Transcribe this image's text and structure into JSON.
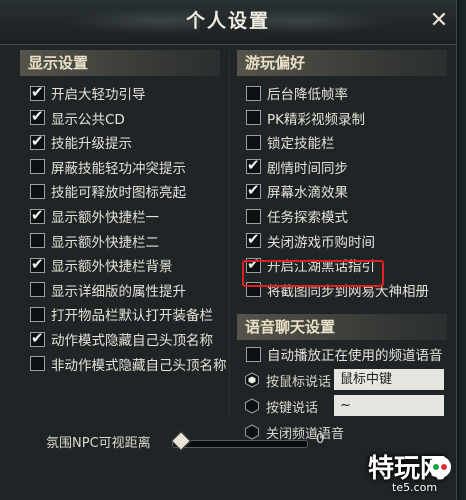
{
  "window": {
    "title": "个人设置",
    "close_symbol": "✕"
  },
  "display_settings": {
    "title": "显示设置",
    "items": [
      {
        "label": "开启大轻功引导",
        "checked": true
      },
      {
        "label": "显示公共CD",
        "checked": true
      },
      {
        "label": "技能升级提示",
        "checked": true
      },
      {
        "label": "屏蔽技能轻功冲突提示",
        "checked": false
      },
      {
        "label": "技能可释放时图标亮起",
        "checked": false
      },
      {
        "label": "显示额外快捷栏一",
        "checked": true
      },
      {
        "label": "显示额外快捷栏二",
        "checked": false
      },
      {
        "label": "显示额外快捷栏背景",
        "checked": true
      },
      {
        "label": "显示详细版的属性提升",
        "checked": false
      },
      {
        "label": "打开物品栏默认打开装备栏",
        "checked": false
      },
      {
        "label": "动作模式隐藏自己头顶名称",
        "checked": true
      },
      {
        "label": "非动作模式隐藏自己头顶名称",
        "checked": false
      }
    ]
  },
  "gameplay_prefs": {
    "title": "游玩偏好",
    "items": [
      {
        "label": "后台降低帧率",
        "checked": false
      },
      {
        "label": "PK精彩视频录制",
        "checked": false
      },
      {
        "label": "锁定技能栏",
        "checked": false
      },
      {
        "label": "剧情时间同步",
        "checked": true
      },
      {
        "label": "屏幕水滴效果",
        "checked": true
      },
      {
        "label": "任务探索模式",
        "checked": false
      },
      {
        "label": "关闭游戏币购时间",
        "checked": true
      },
      {
        "label": "开启江湖黑话指引",
        "checked": true
      },
      {
        "label": "将截图同步到网易大神相册",
        "checked": false
      }
    ]
  },
  "voice_chat": {
    "title": "语音聊天设置",
    "auto_play": {
      "label": "自动播放正在使用的频道语音",
      "checked": false
    },
    "mouse_talk": {
      "label": "按鼠标说话",
      "value": "鼠标中键",
      "selected": true
    },
    "key_talk": {
      "label": "按键说话",
      "value": "~",
      "selected": false
    },
    "close_channel": {
      "label": "关闭频道语音",
      "selected": false
    }
  },
  "npc_distance": {
    "label": "氛围NPC可视距离",
    "value": "0",
    "level": 0
  },
  "watermark": {
    "text": "特玩网",
    "sub": "te5.com"
  },
  "colors": {
    "highlight": "#e02020",
    "accent": "#e9e0c8"
  }
}
